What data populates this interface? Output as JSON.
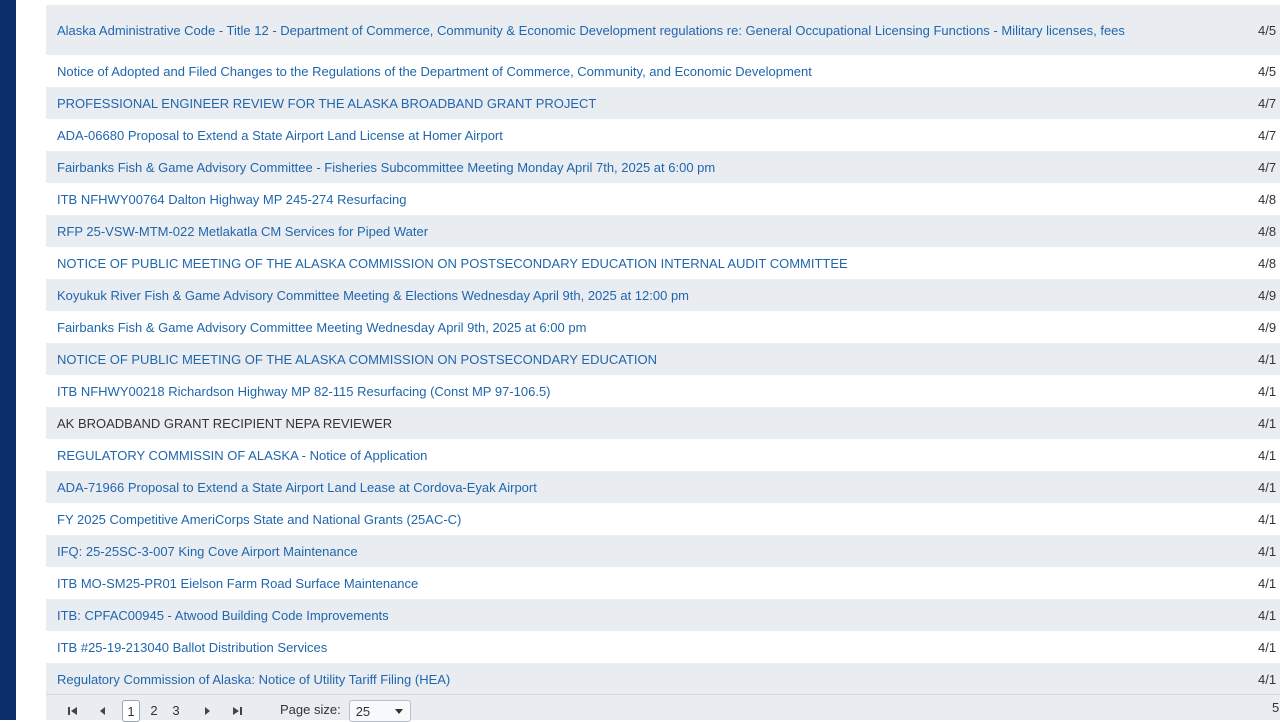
{
  "notices": [
    {
      "title": "Alaska Administrative Code - Title 12 - Department of Commerce, Community & Economic Development regulations re: General Occupational Licensing Functions - Military licenses, fees",
      "date": "4/5"
    },
    {
      "title": "Notice of Adopted and Filed Changes to the Regulations of the Department of Commerce, Community, and Economic Development",
      "date": "4/5"
    },
    {
      "title": "PROFESSIONAL ENGINEER REVIEW FOR THE ALASKA BROADBAND GRANT PROJECT",
      "date": "4/7"
    },
    {
      "title": "ADA-06680 Proposal to Extend a State Airport Land License at Homer Airport",
      "date": "4/7"
    },
    {
      "title": "Fairbanks Fish & Game Advisory Committee - Fisheries Subcommittee Meeting Monday April 7th, 2025 at 6:00 pm",
      "date": "4/7"
    },
    {
      "title": "ITB NFHWY00764 Dalton Highway MP 245-274 Resurfacing",
      "date": "4/8"
    },
    {
      "title": "RFP 25-VSW-MTM-022 Metlakatla CM Services for Piped Water",
      "date": "4/8"
    },
    {
      "title": "NOTICE OF PUBLIC MEETING OF THE ALASKA COMMISSION ON POSTSECONDARY EDUCATION INTERNAL AUDIT COMMITTEE",
      "date": "4/8"
    },
    {
      "title": "Koyukuk River Fish & Game Advisory Committee Meeting & Elections Wednesday April 9th, 2025 at 12:00 pm",
      "date": "4/9"
    },
    {
      "title": "Fairbanks Fish & Game Advisory Committee Meeting Wednesday April 9th, 2025 at 6:00 pm",
      "date": "4/9"
    },
    {
      "title": "NOTICE OF PUBLIC MEETING OF THE ALASKA COMMISSION ON POSTSECONDARY EDUCATION",
      "date": "4/1"
    },
    {
      "title": "ITB NFHWY00218 Richardson Highway MP 82-115 Resurfacing (Const MP 97-106.5)",
      "date": "4/1"
    },
    {
      "title": "AK BROADBAND GRANT RECIPIENT NEPA REVIEWER",
      "date": "4/1"
    },
    {
      "title": "REGULATORY COMMISSIN OF ALASKA - Notice of Application",
      "date": "4/1"
    },
    {
      "title": "ADA-71966 Proposal to Extend a State Airport Land Lease at Cordova-Eyak Airport",
      "date": "4/1"
    },
    {
      "title": "FY 2025 Competitive AmeriCorps State and National Grants (25AC-C)",
      "date": "4/1"
    },
    {
      "title": "IFQ: 25-25SC-3-007 King Cove Airport Maintenance",
      "date": "4/1"
    },
    {
      "title": "ITB MO-SM25-PR01 Eielson Farm Road Surface Maintenance",
      "date": "4/1"
    },
    {
      "title": "ITB: CPFAC00945 - Atwood Building Code Improvements",
      "date": "4/1"
    },
    {
      "title": "ITB #25-19-213040 Ballot Distribution Services",
      "date": "4/1"
    },
    {
      "title": "Regulatory Commission of Alaska: Notice of Utility Tariff Filing (HEA)",
      "date": "4/1"
    }
  ],
  "pager": {
    "first_icon": "first-page-icon",
    "prev_icon": "prev-page-icon",
    "next_icon": "next-page-icon",
    "last_icon": "last-page-icon",
    "pages": [
      "1",
      "2",
      "3"
    ],
    "current_page": "1",
    "page_size_label": "Page size:",
    "page_size_value": "25",
    "right_text": "5"
  },
  "colors": {
    "link": "#1f66ad",
    "row_alt": "#e9edf2",
    "left_bar": "#0b2f6b"
  }
}
